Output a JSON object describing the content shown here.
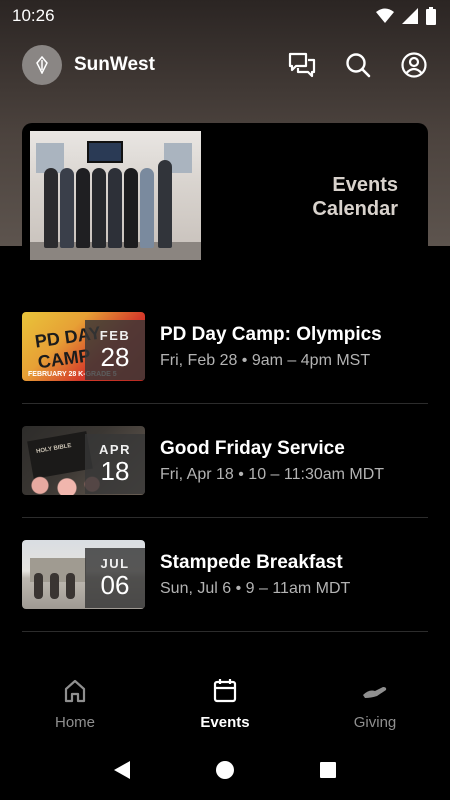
{
  "status_bar": {
    "time": "10:26",
    "icons": [
      "wifi-icon",
      "signal-icon",
      "battery-icon"
    ]
  },
  "header": {
    "app_name": "SunWest",
    "actions": [
      "chat-icon",
      "search-icon",
      "account-icon"
    ]
  },
  "banner": {
    "title_line1": "Events",
    "title_line2": "Calendar"
  },
  "events": [
    {
      "title": "PD Day Camp: Olympics",
      "meta": "Fri, Feb 28 • 9am – 4pm MST",
      "month": "FEB",
      "day": "28",
      "thumb_text": "PD DAY CAMP",
      "thumb_footer": "FEBRUARY 28  K-GRADE 5"
    },
    {
      "title": "Good Friday Service",
      "meta": "Fri, Apr 18 • 10 – 11:30am MDT",
      "month": "APR",
      "day": "18",
      "thumb_text": "HOLY BIBLE"
    },
    {
      "title": "Stampede Breakfast",
      "meta": "Sun, Jul 6 • 9 – 11am MDT",
      "month": "JUL",
      "day": "06"
    }
  ],
  "bottom_nav": [
    {
      "label": "Home",
      "icon": "home-icon",
      "active": false
    },
    {
      "label": "Events",
      "icon": "calendar-icon",
      "active": true
    },
    {
      "label": "Giving",
      "icon": "giving-hand-icon",
      "active": false
    }
  ],
  "colors": {
    "background": "#000000",
    "hero": "#4c433e",
    "badge": "#373737",
    "muted_text": "#b3b3b3"
  }
}
